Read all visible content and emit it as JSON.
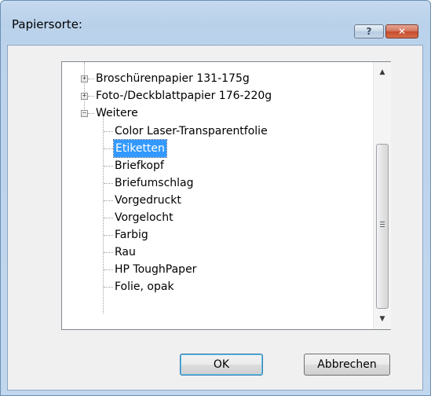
{
  "window": {
    "title": "Papiersorte:",
    "help_label": "?",
    "close_label": "✕"
  },
  "tree": {
    "items": [
      {
        "label": "Broschürenpapier 131-175g",
        "expander": "+"
      },
      {
        "label": "Foto-/Deckblattpapier 176-220g",
        "expander": "+"
      },
      {
        "label": "Weitere",
        "expander": "−"
      },
      {
        "label": "Color Laser-Transparentfolie"
      },
      {
        "label": "Etiketten",
        "selected": true
      },
      {
        "label": "Briefkopf"
      },
      {
        "label": "Briefumschlag"
      },
      {
        "label": "Vorgedruckt"
      },
      {
        "label": "Vorgelocht"
      },
      {
        "label": "Farbig"
      },
      {
        "label": "Rau"
      },
      {
        "label": "HP ToughPaper"
      },
      {
        "label": "Folie, opak"
      }
    ]
  },
  "scrollbar": {
    "up_icon": "▲",
    "down_icon": "▼"
  },
  "buttons": {
    "ok_label": "OK",
    "cancel_label": "Abbrechen"
  },
  "colors": {
    "selection": "#3399ff",
    "titlebar": "#b9d1ea",
    "close": "#c44a2b"
  }
}
